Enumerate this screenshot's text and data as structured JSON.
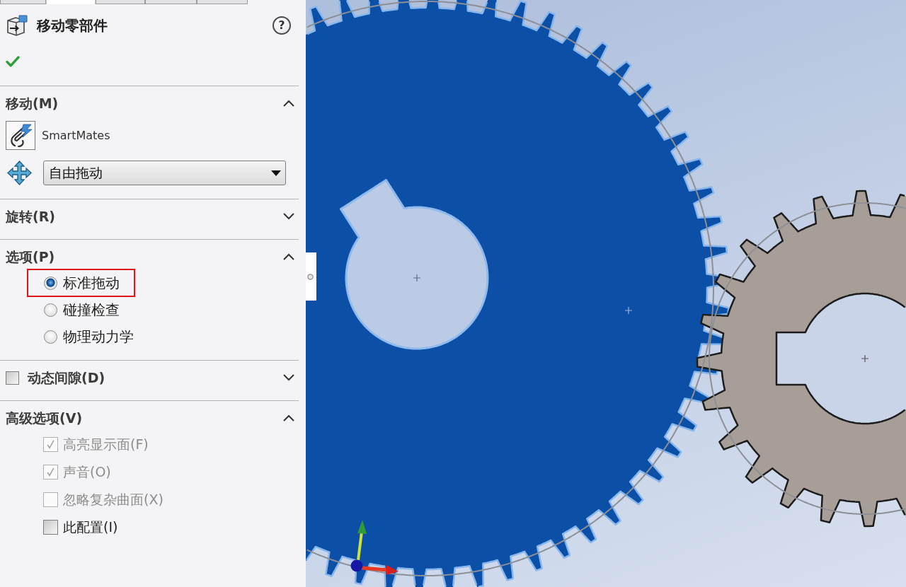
{
  "panel_tabs": [
    {
      "selected": false
    },
    {
      "selected": true
    },
    {
      "selected": false
    },
    {
      "selected": false
    },
    {
      "selected": false
    }
  ],
  "header": {
    "title": "移动零部件",
    "help": "?"
  },
  "sections": [
    {
      "kind": "move",
      "title": "移动(M)",
      "expanded": true,
      "smartmates": "SmartMates",
      "drag_mode": "自由拖动"
    },
    {
      "kind": "group",
      "title": "旋转(R)",
      "expanded": false
    },
    {
      "kind": "radios",
      "title": "选项(P)",
      "expanded": true,
      "options": [
        {
          "label": "标准拖动",
          "selected": true,
          "highlighted": true
        },
        {
          "label": "碰撞检查",
          "selected": false,
          "highlighted": false
        },
        {
          "label": "物理动力学",
          "selected": false,
          "highlighted": false
        }
      ]
    },
    {
      "kind": "toggle",
      "title": "动态间隙(D)",
      "expanded": false,
      "checked": false
    },
    {
      "kind": "checks",
      "title": "高级选项(V)",
      "expanded": true,
      "options": [
        {
          "label": "高亮显示面(F)",
          "checked": true,
          "disabled": true
        },
        {
          "label": "声音(O)",
          "checked": true,
          "disabled": true
        },
        {
          "label": "忽略复杂曲面(X)",
          "checked": false,
          "disabled": true
        },
        {
          "label": "此配置(I)",
          "checked": false,
          "disabled": false
        }
      ]
    }
  ]
}
